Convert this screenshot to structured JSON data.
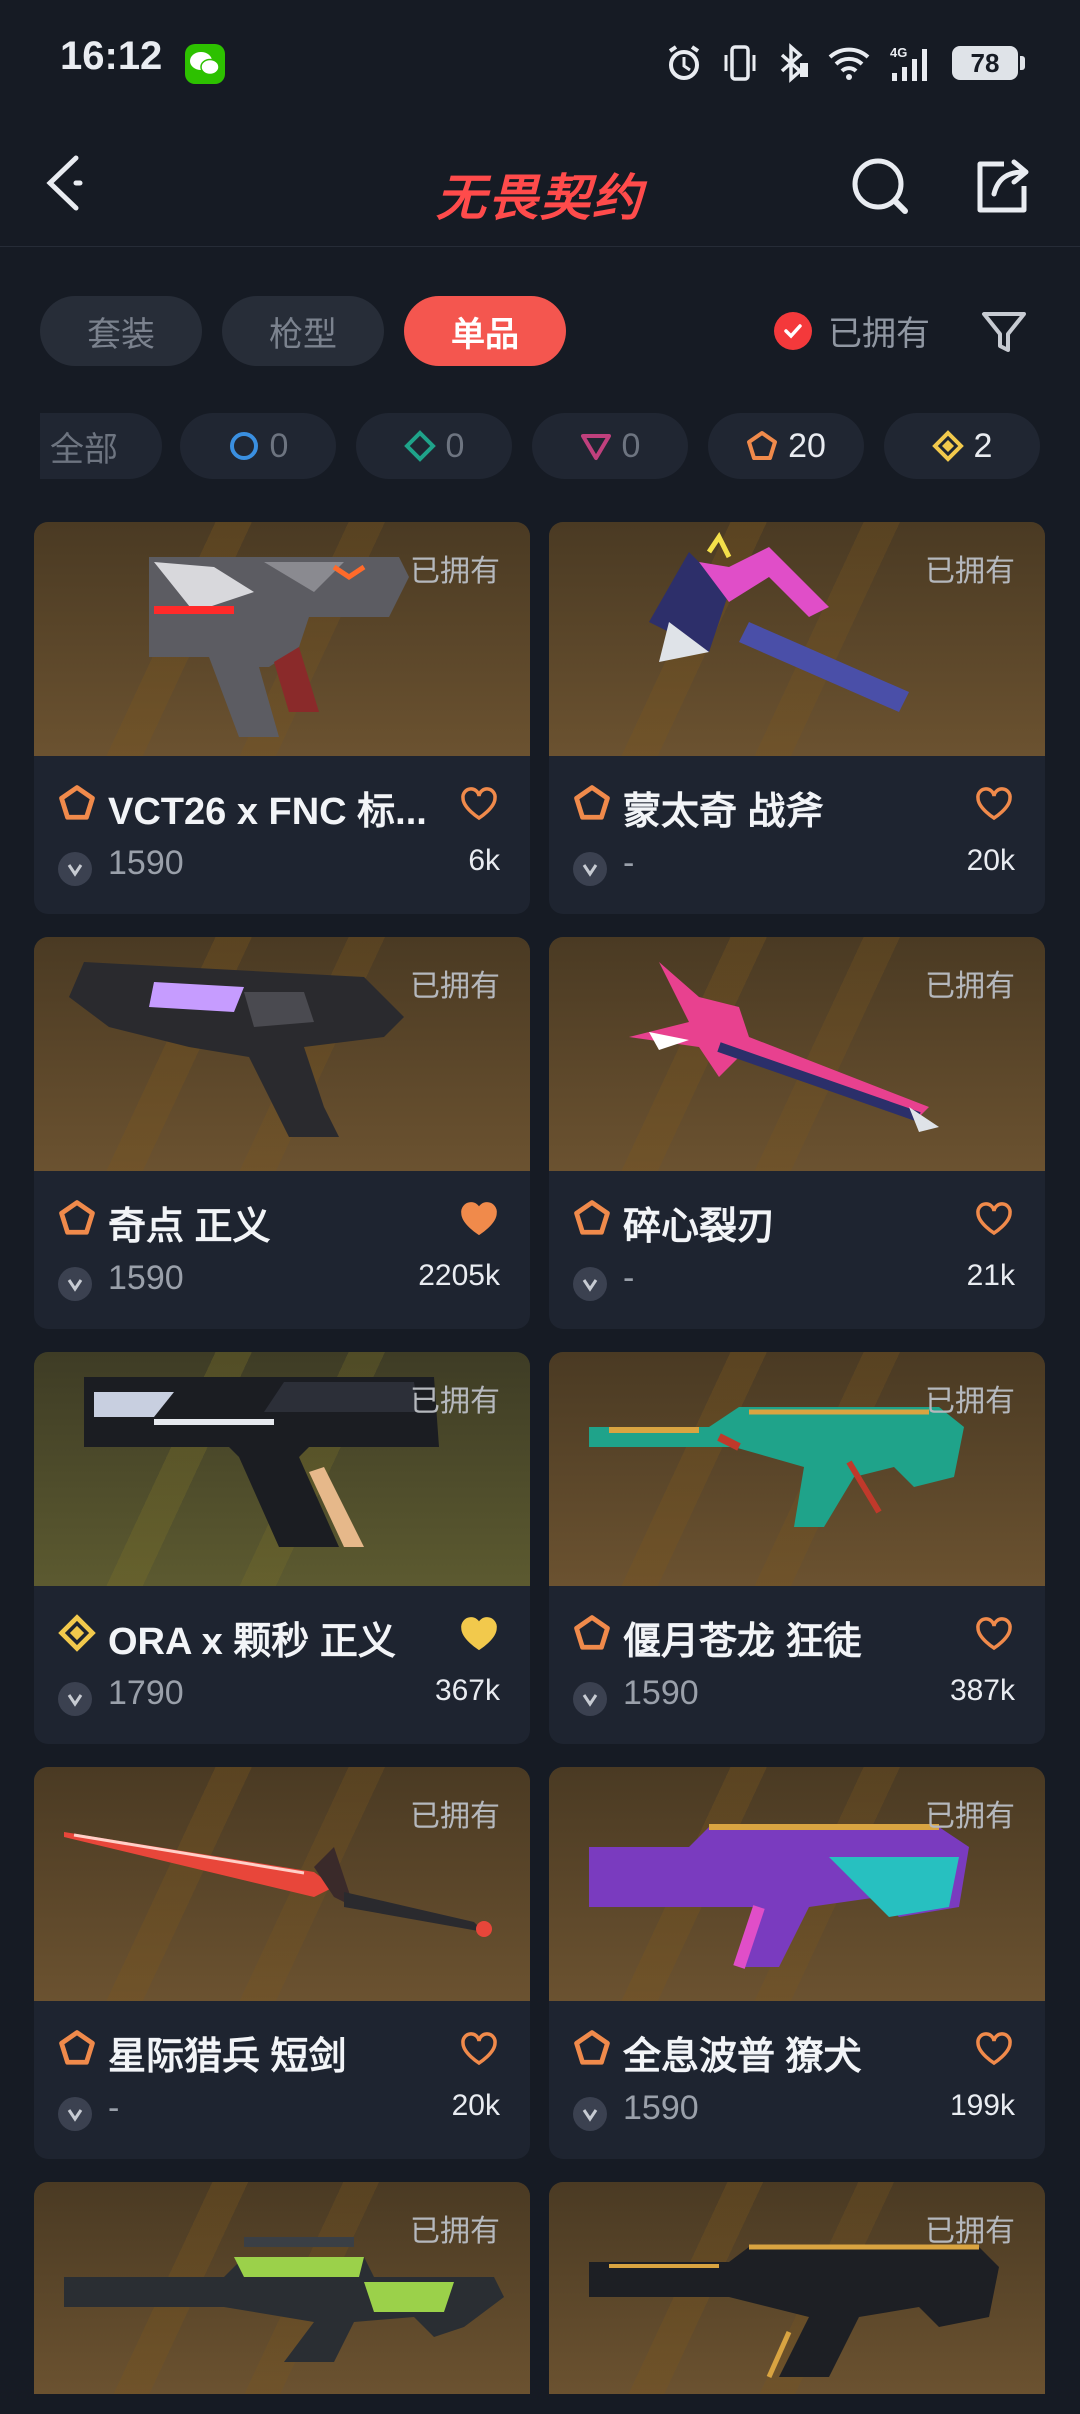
{
  "status": {
    "time": "16:12",
    "battery": "78"
  },
  "header": {
    "title": "无畏契约"
  },
  "tabs": [
    {
      "label": "套装",
      "active": false
    },
    {
      "label": "枪型",
      "active": false
    },
    {
      "label": "单品",
      "active": true
    }
  ],
  "owned_filter_label": "已拥有",
  "chips": [
    {
      "label": "全部",
      "count": ""
    },
    {
      "label": "",
      "count": "0",
      "icon": "select-tier-icon"
    },
    {
      "label": "",
      "count": "0",
      "icon": "deluxe-tier-icon"
    },
    {
      "label": "",
      "count": "0",
      "icon": "premium-tier-icon"
    },
    {
      "label": "",
      "count": "20",
      "icon": "exclusive-tier-icon"
    },
    {
      "label": "",
      "count": "2",
      "icon": "ultra-tier-icon"
    }
  ],
  "colors": {
    "accent": "#f4564f",
    "exclusive": "#f08a4b",
    "ultra": "#f2c94c"
  },
  "items": [
    {
      "owned": "已拥有",
      "name": "VCT26 x FNC 标...",
      "price": "1590",
      "likes": "6k",
      "tier": "exclusive",
      "favorited": false
    },
    {
      "owned": "已拥有",
      "name": "蒙太奇 战斧",
      "price": "-",
      "likes": "20k",
      "tier": "exclusive",
      "favorited": false
    },
    {
      "owned": "已拥有",
      "name": "奇点 正义",
      "price": "1590",
      "likes": "2205k",
      "tier": "exclusive",
      "favorited": true
    },
    {
      "owned": "已拥有",
      "name": "碎心裂刃",
      "price": "-",
      "likes": "21k",
      "tier": "exclusive",
      "favorited": false
    },
    {
      "owned": "已拥有",
      "name": "ORA x 颗秒 正义",
      "price": "1790",
      "likes": "367k",
      "tier": "ultra",
      "favorited": true
    },
    {
      "owned": "已拥有",
      "name": "偃月苍龙 狂徒",
      "price": "1590",
      "likes": "387k",
      "tier": "exclusive",
      "favorited": false
    },
    {
      "owned": "已拥有",
      "name": "星际猎兵 短剑",
      "price": "-",
      "likes": "20k",
      "tier": "exclusive",
      "favorited": false
    },
    {
      "owned": "已拥有",
      "name": "全息波普 獠犬",
      "price": "1590",
      "likes": "199k",
      "tier": "exclusive",
      "favorited": false
    },
    {
      "owned": "已拥有",
      "name": "",
      "price": "",
      "likes": "",
      "tier": "exclusive",
      "favorited": false
    },
    {
      "owned": "已拥有",
      "name": "",
      "price": "",
      "likes": "",
      "tier": "exclusive",
      "favorited": false
    }
  ]
}
